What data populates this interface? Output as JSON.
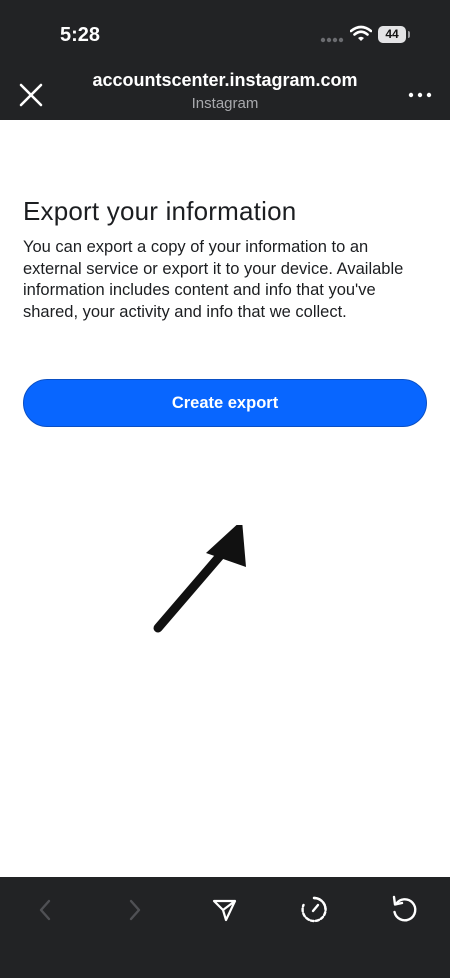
{
  "status_bar": {
    "time": "5:28",
    "battery": "44"
  },
  "browser": {
    "title": "accountscenter.instagram.com",
    "subtitle": "Instagram"
  },
  "page": {
    "heading": "Export your information",
    "description": "You can export a copy of your information to an external service or export it to your device. Available information includes content and info that you've shared, your activity and info that we collect.",
    "create_button": "Create export"
  },
  "icons": {
    "close": "close-icon",
    "more": "more-dots-icon",
    "back": "chevron-left-icon",
    "forward": "chevron-right-icon",
    "share": "send-icon",
    "speed": "gauge-icon",
    "reload": "reload-icon"
  },
  "colors": {
    "bar_background": "#222325",
    "button_blue": "#0866ff",
    "text": "#1c1e21"
  }
}
